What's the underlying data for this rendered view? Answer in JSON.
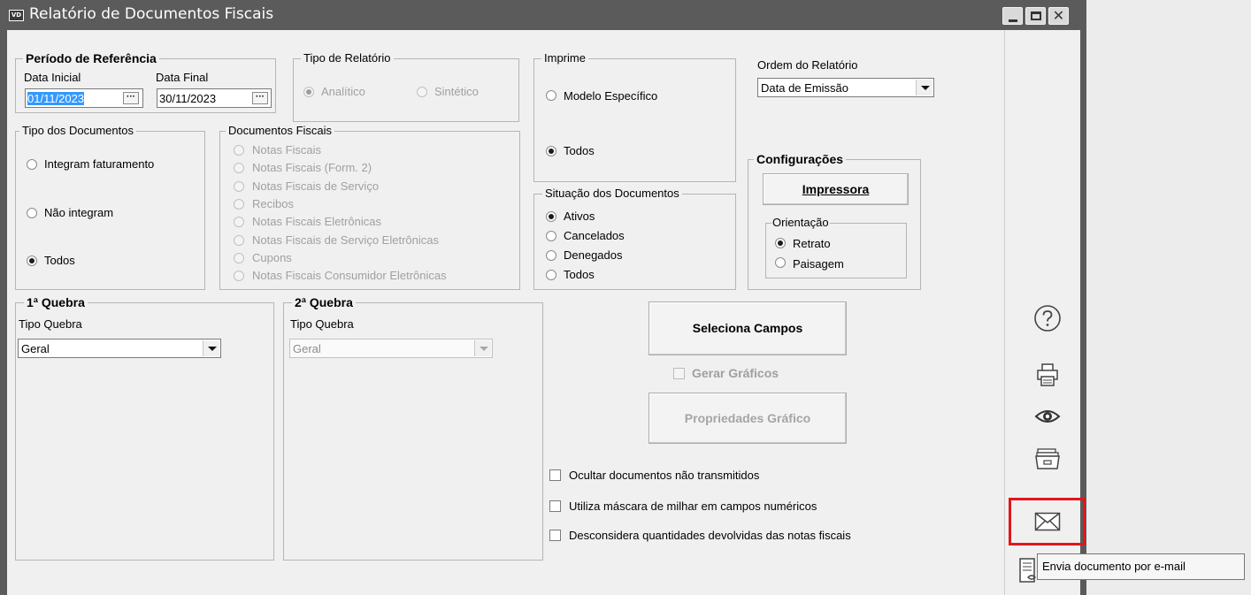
{
  "window": {
    "app_icon_text": "VD",
    "title": "Relatório de Documentos Fiscais",
    "controls": [
      "minimize-icon",
      "maximize-icon",
      "close-icon"
    ]
  },
  "periodo": {
    "legend": "Período de Referência",
    "data_inicial_label": "Data Inicial",
    "data_inicial_value": "01/11/2023",
    "data_final_label": "Data Final",
    "data_final_value": "30/11/2023",
    "picker_glyph": "···"
  },
  "tipo_relatorio": {
    "legend": "Tipo de Relatório",
    "options": [
      {
        "label": "Analítico",
        "checked": true
      },
      {
        "label": "Sintético",
        "checked": false
      }
    ]
  },
  "imprime": {
    "legend": "Imprime",
    "options": [
      {
        "label": "Modelo Específico",
        "checked": false
      },
      {
        "label": "Todos",
        "checked": true
      }
    ]
  },
  "ordem": {
    "label": "Ordem do Relatório",
    "value": "Data de Emissão"
  },
  "tipo_documentos": {
    "legend": "Tipo dos Documentos",
    "options": [
      {
        "label": "Integram faturamento",
        "checked": false
      },
      {
        "label": "Não integram",
        "checked": false
      },
      {
        "label": "Todos",
        "checked": true
      }
    ]
  },
  "documentos_fiscais": {
    "legend": "Documentos Fiscais",
    "options": [
      "Notas Fiscais",
      "Notas Fiscais (Form. 2)",
      "Notas Fiscais de Serviço",
      "Recibos",
      "Notas Fiscais Eletrônicas",
      "Notas Fiscais de Serviço Eletrônicas",
      "Cupons",
      "Notas Fiscais Consumidor Eletrônicas"
    ]
  },
  "situacao": {
    "legend": "Situação dos Documentos",
    "options": [
      {
        "label": "Ativos",
        "checked": true
      },
      {
        "label": "Cancelados",
        "checked": false
      },
      {
        "label": "Denegados",
        "checked": false
      },
      {
        "label": "Todos",
        "checked": false
      }
    ]
  },
  "configuracoes": {
    "legend": "Configurações",
    "impressora_button": "Impressora",
    "orientacao_legend": "Orientação",
    "options": [
      {
        "label": "Retrato",
        "checked": true
      },
      {
        "label": "Paisagem",
        "checked": false
      }
    ]
  },
  "quebra1": {
    "legend": "1ª Quebra",
    "tipo_label": "Tipo Quebra",
    "value": "Geral"
  },
  "quebra2": {
    "legend": "2ª Quebra",
    "tipo_label": "Tipo Quebra",
    "value": "Geral"
  },
  "actions": {
    "seleciona_campos": "Seleciona Campos",
    "gerar_graficos": "Gerar Gráficos",
    "propriedades_grafico": "Propriedades Gráfico"
  },
  "checkboxes": [
    {
      "label": "Ocultar documentos não transmitidos",
      "checked": false
    },
    {
      "label": "Utiliza máscara de milhar em campos numéricos",
      "checked": false
    },
    {
      "label": "Desconsidera quantidades devolvidas das notas fiscais",
      "checked": false
    }
  ],
  "sidebar": {
    "icons": [
      "help-icon",
      "printer-icon",
      "preview-eye-icon",
      "export-folder-icon",
      "email-envelope-icon",
      "document-icon"
    ],
    "highlight_color": "#e2161b"
  },
  "tooltip": {
    "text": "Envia documento por e-mail"
  }
}
